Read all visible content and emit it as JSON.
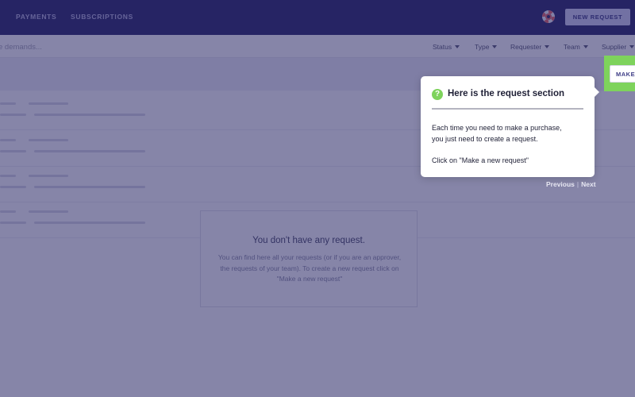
{
  "nav": {
    "items": [
      "PAYMENTS",
      "SUBSCRIPTIONS"
    ],
    "help_icon": "lifebuoy-icon",
    "new_request_label": "NEW REQUEST"
  },
  "filters": {
    "search_placeholder": "e demands...",
    "items": [
      "Status",
      "Type",
      "Requester",
      "Team",
      "Supplier"
    ]
  },
  "spotlight": {
    "button_label": "MAKE A NEW REQUEST",
    "highlight_color": "#7ed35c"
  },
  "tooltip": {
    "icon": "question-circle-icon",
    "title": "Here is the request section",
    "body_line1": "Each time you need to make a purchase,",
    "body_line2": "you just need to create a request.",
    "cta": "Click on \"Make a new request\""
  },
  "pagination": {
    "previous": "Previous",
    "separator": "|",
    "next": "Next"
  },
  "empty_state": {
    "title": "You don't have any request.",
    "text": "You can find here all your requests (or if you are an approver, the requests of your team). To create a new request click on \"Make a new request\""
  },
  "colors": {
    "topbar": "#2e2d6c",
    "overlay": "#201e5e",
    "accent_green": "#7ed35c"
  }
}
